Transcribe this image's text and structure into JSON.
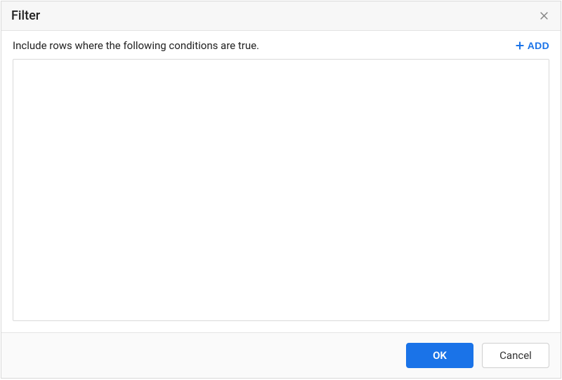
{
  "dialog": {
    "title": "Filter",
    "body": {
      "description": "Include rows where the following conditions are true.",
      "add_label": "ADD"
    },
    "footer": {
      "ok_label": "OK",
      "cancel_label": "Cancel"
    }
  }
}
